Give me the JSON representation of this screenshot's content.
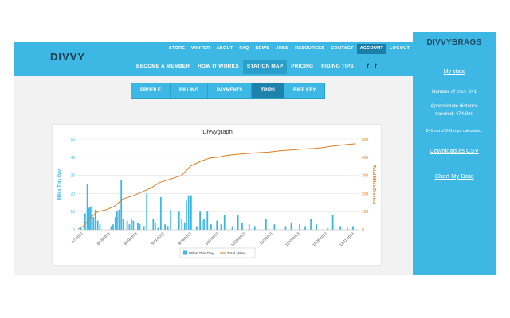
{
  "header": {
    "logo_text": "DIVVY",
    "top_nav": [
      "STORE",
      "WINTER",
      "ABOUT",
      "FAQ",
      "NEWS",
      "JOBS",
      "RESOURCES",
      "CONTACT",
      "ACCOUNT",
      "LOGOUT"
    ],
    "top_nav_active": "ACCOUNT",
    "main_nav": [
      "BECOME A MEMBER",
      "HOW IT WORKS",
      "STATION MAP",
      "PRICING",
      "RIDING TIPS"
    ],
    "main_nav_active": "STATION MAP",
    "social": {
      "facebook": "f",
      "twitter": "t"
    }
  },
  "tabs": {
    "items": [
      "PROFILE",
      "BILLING",
      "PAYMENTS",
      "TRIPS",
      "BIKE KEY"
    ],
    "active": "TRIPS"
  },
  "sidebar": {
    "title": "DIVVYBRAGS",
    "my_stats": "My stats",
    "trips_stat": "Number of trips: 241",
    "distance_stat": "Approximate distance traveled: 474.9mi",
    "calc_stat": "241 out of 241 trips calculated.",
    "download_csv": "Download as CSV",
    "chart_my_data": "Chart My Data"
  },
  "colors": {
    "brand_blue": "#3db7e4",
    "dark_blue": "#1f82ad",
    "bar_color": "#3db7e4",
    "line_color": "#e07b1f",
    "content_bg": "#f2f2f2"
  },
  "chart_data": {
    "type": "bar",
    "title": "Divvygraph",
    "ylabel": "Miles This Day",
    "y2label": "Total Miles Divvied",
    "ylim": [
      0,
      50
    ],
    "y2lim": [
      0,
      500
    ],
    "yticks": [
      0,
      10,
      20,
      30,
      40,
      50
    ],
    "y2ticks": [
      0,
      100,
      200,
      300,
      400,
      500
    ],
    "xticks": [
      "8/7/2013",
      "8/18/2013",
      "8/29/2013",
      "9/11/2013",
      "9/24/2013",
      "10/7/2013",
      "10/20/2013",
      "11/2/2013",
      "11/15/2013",
      "11/28/2013",
      "12/11/2013"
    ],
    "legend": [
      "Miles This Day",
      "Total Miles"
    ],
    "legend_position": "bottom",
    "grid": true,
    "x_range": [
      0,
      100
    ],
    "bars": {
      "name": "Miles This Day",
      "x": [
        1,
        2.5,
        3.3,
        3.8,
        4.3,
        4.9,
        5.5,
        6.2,
        7,
        7.8,
        11.8,
        12.5,
        13.3,
        13.9,
        14.6,
        15.4,
        16.1,
        17.5,
        18.3,
        19,
        19.7,
        21.3,
        22,
        23.5,
        24.5,
        26.8,
        27.5,
        28.5,
        29.5,
        31,
        32,
        33,
        36,
        37,
        38,
        38.6,
        39.4,
        40.3,
        42.3,
        43.5,
        44.2,
        44.9,
        46.1,
        47.4,
        49.5,
        51,
        52.2,
        55,
        57,
        58.5,
        61,
        63,
        67,
        70,
        74,
        76,
        79,
        81,
        83,
        85,
        89,
        90.8,
        93.5,
        96,
        98
      ],
      "y": [
        1,
        9,
        25,
        12,
        12.5,
        13,
        7,
        11,
        5,
        3,
        2,
        3,
        7,
        10,
        11,
        27.5,
        6,
        5,
        3,
        6,
        5,
        4,
        3,
        2,
        20,
        6,
        4,
        1,
        18,
        3,
        2,
        11,
        10,
        6,
        4,
        16,
        19,
        19,
        2,
        10,
        5,
        6,
        10,
        3,
        5,
        3,
        8,
        2,
        8,
        4,
        3,
        2,
        6,
        3,
        2,
        4,
        3,
        2,
        6,
        3,
        1,
        8,
        2,
        1,
        2
      ]
    },
    "line": {
      "name": "Total Miles",
      "x": [
        0,
        2,
        4,
        7,
        10,
        13,
        16,
        20,
        23,
        26,
        29,
        33,
        37,
        40,
        44,
        47,
        50,
        53,
        56,
        60,
        64,
        68,
        72,
        76,
        80,
        84,
        87,
        90,
        93,
        96,
        99
      ],
      "y": [
        5,
        20,
        60,
        100,
        110,
        130,
        170,
        190,
        210,
        230,
        260,
        280,
        300,
        350,
        380,
        395,
        400,
        410,
        415,
        420,
        425,
        428,
        435,
        440,
        445,
        448,
        452,
        460,
        465,
        470,
        474
      ]
    }
  }
}
